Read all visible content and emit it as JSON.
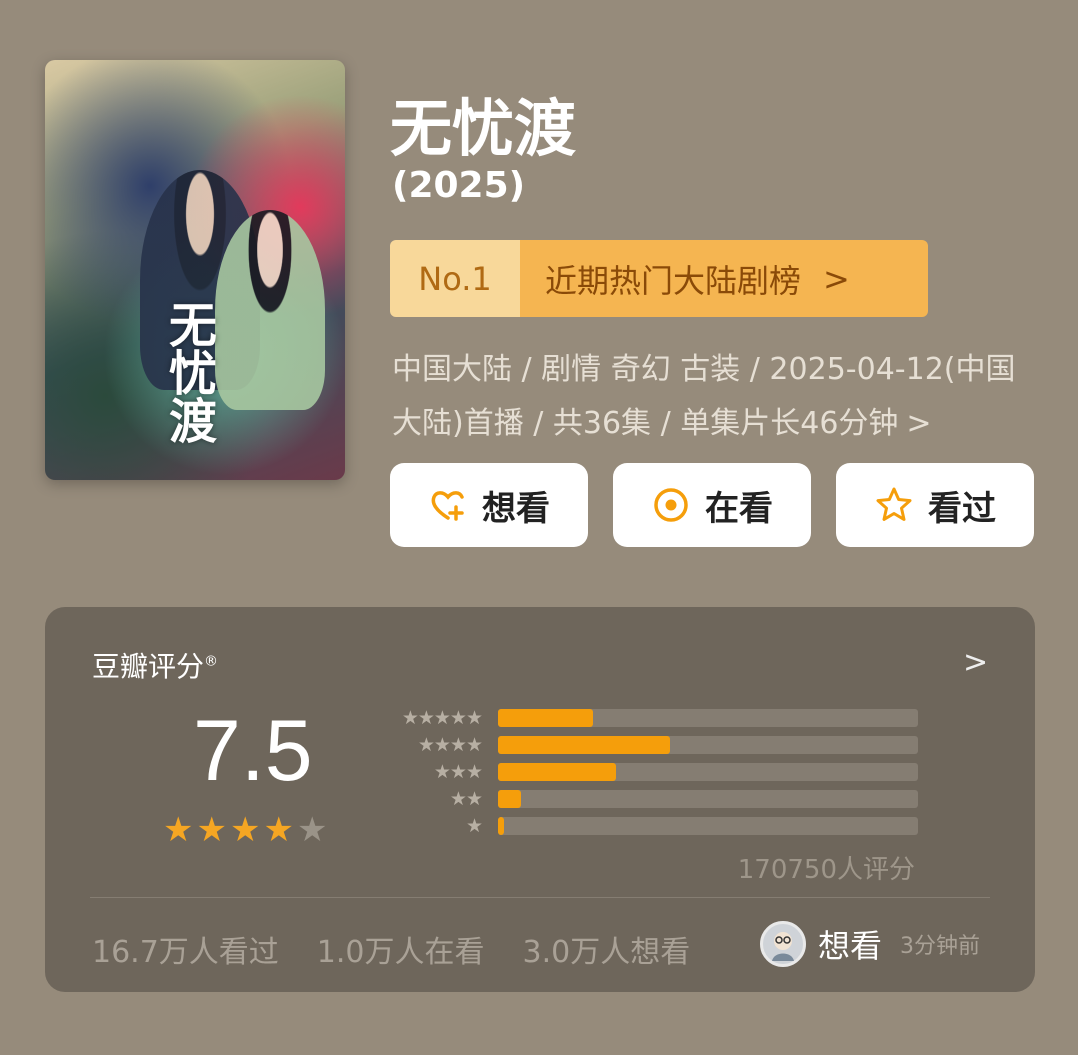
{
  "poster": {
    "calligraphy": "无忧渡"
  },
  "show": {
    "title": "无忧渡",
    "year": "(2025)"
  },
  "ranking": {
    "position": "No.1",
    "list_name": "近期热门大陆剧榜",
    "arrow": ">"
  },
  "meta": {
    "text": "中国大陆 / 剧情 奇幻 古装 / 2025-04-12(中国大陆)首播 / 共36集 / 单集片长46分钟",
    "chevron": ">"
  },
  "actions": [
    {
      "label": "想看",
      "icon": "heart-plus-icon"
    },
    {
      "label": "在看",
      "icon": "target-icon"
    },
    {
      "label": "看过",
      "icon": "star-outline-icon"
    }
  ],
  "rating": {
    "label": "豆瓣评分",
    "registered": "®",
    "more": ">",
    "score": "7.5",
    "stars_full": 4,
    "stars_total": 5,
    "distribution": [
      {
        "stars": "★★★★★",
        "percent": 22.5
      },
      {
        "stars": "★★★★",
        "percent": 41
      },
      {
        "stars": "★★★",
        "percent": 28
      },
      {
        "stars": "★★",
        "percent": 5.5
      },
      {
        "stars": "★",
        "percent": 1.5
      }
    ],
    "count_text": "170750人评分",
    "colors": {
      "accent": "#f59e0b",
      "track": "#857d72"
    }
  },
  "stats": {
    "watched": "16.7万人看过",
    "watching": "1.0万人在看",
    "want": "3.0万人想看"
  },
  "activity": {
    "action": "想看",
    "time": "3分钟前"
  }
}
